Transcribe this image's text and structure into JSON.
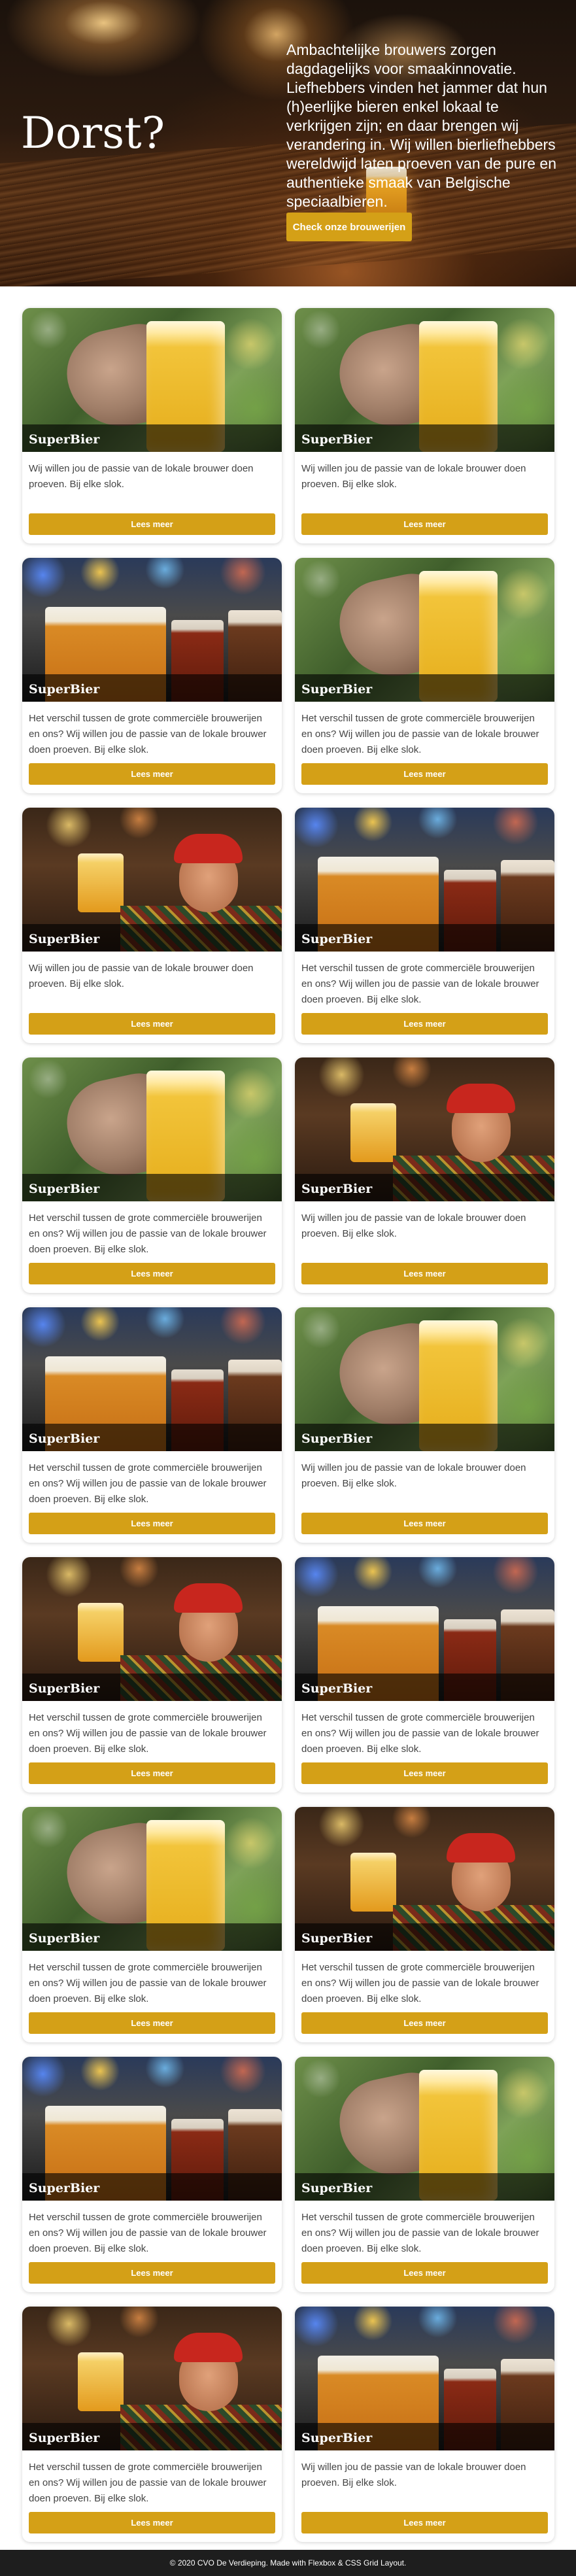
{
  "hero": {
    "title": "Dorst?",
    "text": "Ambachtelijke brouwers zorgen dagdagelijks voor smaakinnovatie. Liefhebbers vinden het jammer dat hun (h)eerlijke bieren enkel lokaal te verkrijgen zijn; en daar brengen wij verandering in. Wij willen bierliefhebbers wereldwijd laten proeven van de pure en authentieke smaak van Belgische speciaalbieren.",
    "button_label": "Check onze brouwerijen"
  },
  "cards": [
    {
      "image": "hand-holding-beer",
      "name": "SuperBier",
      "text": "Wij willen jou de passie van de lokale brouwer doen proeven. Bij elke slok.",
      "button_label": "Lees meer"
    },
    {
      "image": "hand-holding-beer",
      "name": "SuperBier",
      "text": "Wij willen jou de passie van de lokale brouwer doen proeven. Bij elke slok.",
      "button_label": "Lees meer"
    },
    {
      "image": "three-beers",
      "name": "SuperBier",
      "text": "Het verschil tussen de grote commerciële brouwerijen en ons? Wij willen jou de passie van de lokale brouwer doen proeven. Bij elke slok.",
      "button_label": "Lees meer"
    },
    {
      "image": "hand-holding-beer",
      "name": "SuperBier",
      "text": "Het verschil tussen de grote commerciële brouwerijen en ons? Wij willen jou de passie van de lokale brouwer doen proeven. Bij elke slok.",
      "button_label": "Lees meer"
    },
    {
      "image": "cheering-man",
      "name": "SuperBier",
      "text": "Wij willen jou de passie van de lokale brouwer doen proeven. Bij elke slok.",
      "button_label": "Lees meer"
    },
    {
      "image": "three-beers",
      "name": "SuperBier",
      "text": "Het verschil tussen de grote commerciële brouwerijen en ons? Wij willen jou de passie van de lokale brouwer doen proeven. Bij elke slok.",
      "button_label": "Lees meer"
    },
    {
      "image": "hand-holding-beer",
      "name": "SuperBier",
      "text": "Het verschil tussen de grote commerciële brouwerijen en ons? Wij willen jou de passie van de lokale brouwer doen proeven. Bij elke slok.",
      "button_label": "Lees meer"
    },
    {
      "image": "cheering-man",
      "name": "SuperBier",
      "text": "Wij willen jou de passie van de lokale brouwer doen proeven. Bij elke slok.",
      "button_label": "Lees meer"
    },
    {
      "image": "three-beers",
      "name": "SuperBier",
      "text": "Het verschil tussen de grote commerciële brouwerijen en ons? Wij willen jou de passie van de lokale brouwer doen proeven. Bij elke slok.",
      "button_label": "Lees meer"
    },
    {
      "image": "hand-holding-beer",
      "name": "SuperBier",
      "text": "Wij willen jou de passie van de lokale brouwer doen proeven. Bij elke slok.",
      "button_label": "Lees meer"
    },
    {
      "image": "cheering-man",
      "name": "SuperBier",
      "text": "Het verschil tussen de grote commerciële brouwerijen en ons? Wij willen jou de passie van de lokale brouwer doen proeven. Bij elke slok.",
      "button_label": "Lees meer"
    },
    {
      "image": "three-beers",
      "name": "SuperBier",
      "text": "Het verschil tussen de grote commerciële brouwerijen en ons? Wij willen jou de passie van de lokale brouwer doen proeven. Bij elke slok.",
      "button_label": "Lees meer"
    },
    {
      "image": "hand-holding-beer",
      "name": "SuperBier",
      "text": "Het verschil tussen de grote commerciële brouwerijen en ons? Wij willen jou de passie van de lokale brouwer doen proeven. Bij elke slok.",
      "button_label": "Lees meer"
    },
    {
      "image": "cheering-man",
      "name": "SuperBier",
      "text": "Het verschil tussen de grote commerciële brouwerijen en ons? Wij willen jou de passie van de lokale brouwer doen proeven. Bij elke slok.",
      "button_label": "Lees meer"
    },
    {
      "image": "three-beers",
      "name": "SuperBier",
      "text": "Het verschil tussen de grote commerciële brouwerijen en ons? Wij willen jou de passie van de lokale brouwer doen proeven. Bij elke slok.",
      "button_label": "Lees meer"
    },
    {
      "image": "hand-holding-beer",
      "name": "SuperBier",
      "text": "Het verschil tussen de grote commerciële brouwerijen en ons? Wij willen jou de passie van de lokale brouwer doen proeven. Bij elke slok.",
      "button_label": "Lees meer"
    },
    {
      "image": "cheering-man",
      "name": "SuperBier",
      "text": "Het verschil tussen de grote commerciële brouwerijen en ons? Wij willen jou de passie van de lokale brouwer doen proeven. Bij elke slok.",
      "button_label": "Lees meer"
    },
    {
      "image": "three-beers",
      "name": "SuperBier",
      "text": "Wij willen jou de passie van de lokale brouwer doen proeven. Bij elke slok.",
      "button_label": "Lees meer"
    }
  ],
  "footer": {
    "text": "© 2020 CVO De Verdieping. Made with Flexbox & CSS Grid Layout."
  },
  "colors": {
    "accent": "#d4a017",
    "footer_bg": "#1e1e1e"
  }
}
